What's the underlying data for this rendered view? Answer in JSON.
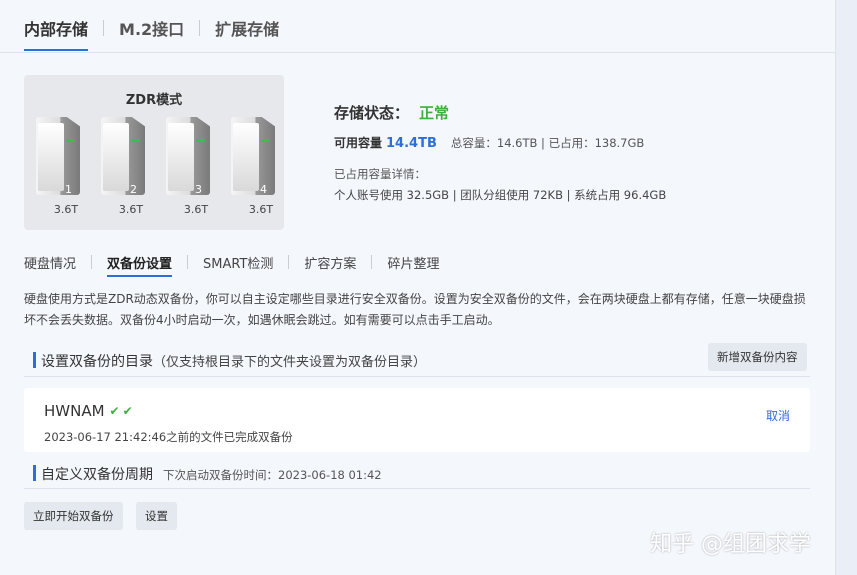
{
  "top_tabs": [
    {
      "label": "内部存储",
      "active": true
    },
    {
      "label": "M.2接口",
      "active": false
    },
    {
      "label": "扩展存储",
      "active": false
    }
  ],
  "disk_card": {
    "mode_title": "ZDR模式",
    "disks": [
      {
        "number": "1",
        "capacity": "3.6T"
      },
      {
        "number": "2",
        "capacity": "3.6T"
      },
      {
        "number": "3",
        "capacity": "3.6T"
      },
      {
        "number": "4",
        "capacity": "3.6T"
      }
    ]
  },
  "status": {
    "label": "存储状态：",
    "value": "正常",
    "available_label": "可用容量",
    "available_value": "14.4TB",
    "capacity_info": "总容量：14.6TB | 已占用：138.7GB",
    "detail_label": "已占用容量详情：",
    "detail_text": "个人账号使用 32.5GB | 团队分组使用 72KB | 系统占用 96.4GB"
  },
  "sub_tabs": [
    {
      "label": "硬盘情况",
      "active": false
    },
    {
      "label": "双备份设置",
      "active": true
    },
    {
      "label": "SMART检测",
      "active": false
    },
    {
      "label": "扩容方案",
      "active": false
    },
    {
      "label": "碎片整理",
      "active": false
    }
  ],
  "description": "硬盘使用方式是ZDR动态双备份，你可以自主设定哪些目录进行安全双备份。设置为安全双备份的文件，会在两块硬盘上都有存储，任意一块硬盘损坏不会丢失数据。双备份4小时启动一次，如遇休眠会跳过。如有需要可以点击手工启动。",
  "backup_dirs": {
    "title": "设置双备份的目录",
    "note": "（仅支持根目录下的文件夹设置为双备份目录）",
    "add_button": "新增双备份内容",
    "entries": [
      {
        "name": "HWNAM",
        "time_text": "2023-06-17 21:42:46之前的文件已完成双备份",
        "cancel_label": "取消"
      }
    ]
  },
  "backup_period": {
    "title": "自定义双备份周期",
    "next_label": "下次启动双备份时间：2023-06-18 01:42",
    "start_button": "立即开始双备份",
    "settings_button": "设置"
  },
  "watermark": "知乎 @组团求学",
  "colors": {
    "accent": "#2d6fd6",
    "ok_green": "#3fae3f"
  }
}
